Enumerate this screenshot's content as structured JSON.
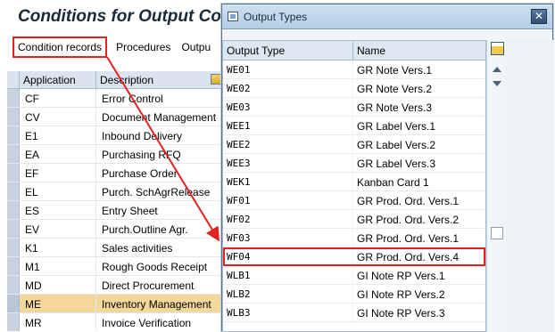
{
  "page": {
    "title": "Conditions for Output Con"
  },
  "menubar": {
    "items": [
      "Condition records",
      "Procedures",
      "Outpu"
    ]
  },
  "left_table": {
    "headers": [
      "Application",
      "Description"
    ],
    "rows": [
      {
        "app": "CF",
        "desc": "Error Control"
      },
      {
        "app": "CV",
        "desc": "Document Management"
      },
      {
        "app": "E1",
        "desc": "Inbound Delivery"
      },
      {
        "app": "EA",
        "desc": "Purchasing RFQ"
      },
      {
        "app": "EF",
        "desc": "Purchase Order"
      },
      {
        "app": "EL",
        "desc": "Purch. SchAgrRelease"
      },
      {
        "app": "ES",
        "desc": "Entry Sheet"
      },
      {
        "app": "EV",
        "desc": "Purch.Outline Agr."
      },
      {
        "app": "K1",
        "desc": "Sales activities"
      },
      {
        "app": "M1",
        "desc": "Rough Goods Receipt"
      },
      {
        "app": "MD",
        "desc": "Direct Procurement"
      },
      {
        "app": "ME",
        "desc": "Inventory Management"
      },
      {
        "app": "MR",
        "desc": "Invoice Verification"
      }
    ],
    "selected_index": 11
  },
  "popup": {
    "title": "Output Types",
    "headers": [
      "Output Type",
      "Name"
    ],
    "rows": [
      {
        "type": "WE01",
        "name": "GR Note Vers.1"
      },
      {
        "type": "WE02",
        "name": "GR Note Vers.2"
      },
      {
        "type": "WE03",
        "name": "GR Note Vers.3"
      },
      {
        "type": "WEE1",
        "name": "GR Label Vers.1"
      },
      {
        "type": "WEE2",
        "name": "GR Label Vers.2"
      },
      {
        "type": "WEE3",
        "name": "GR Label Vers.3"
      },
      {
        "type": "WEK1",
        "name": "Kanban Card 1"
      },
      {
        "type": "WF01",
        "name": "GR Prod. Ord. Vers.1"
      },
      {
        "type": "WF02",
        "name": "GR Prod. Ord. Vers.2"
      },
      {
        "type": "WF03",
        "name": "GR Prod. Ord. Vers.1"
      },
      {
        "type": "WF04",
        "name": "GR Prod. Ord. Vers.4"
      },
      {
        "type": "WLB1",
        "name": "GI Note RP Vers.1"
      },
      {
        "type": "WLB2",
        "name": "GI Note RP Vers.2"
      },
      {
        "type": "WLB3",
        "name": "GI Note RP Vers.3"
      }
    ],
    "highlight_index": 10,
    "close_label": "✕"
  },
  "colors": {
    "highlight": "#e32222",
    "selected_row": "#f3d89a"
  }
}
